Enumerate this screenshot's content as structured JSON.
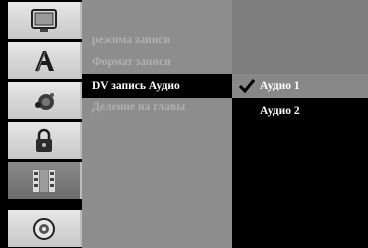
{
  "icons": [
    {
      "name": "tv-icon",
      "active": false
    },
    {
      "name": "language-icon",
      "active": false
    },
    {
      "name": "audio-icon",
      "active": false
    },
    {
      "name": "lock-icon",
      "active": false
    },
    {
      "name": "film-recording-icon",
      "active": true
    },
    {
      "name": "disc-icon",
      "active": false
    }
  ],
  "menu": {
    "items": [
      {
        "label": "режима записи",
        "active": false
      },
      {
        "label": "Формат записи",
        "active": false
      },
      {
        "label": "DV запись Аудио",
        "active": true
      },
      {
        "label": "Деление на главы",
        "active": false
      }
    ]
  },
  "options": {
    "items": [
      {
        "label": "Аудио 1",
        "selected": true
      },
      {
        "label": "Аудио 2",
        "selected": false
      }
    ]
  },
  "colors": {
    "menu_bg": "#8d8d8d",
    "active_row": "#000000",
    "selected_option": "#888888"
  }
}
